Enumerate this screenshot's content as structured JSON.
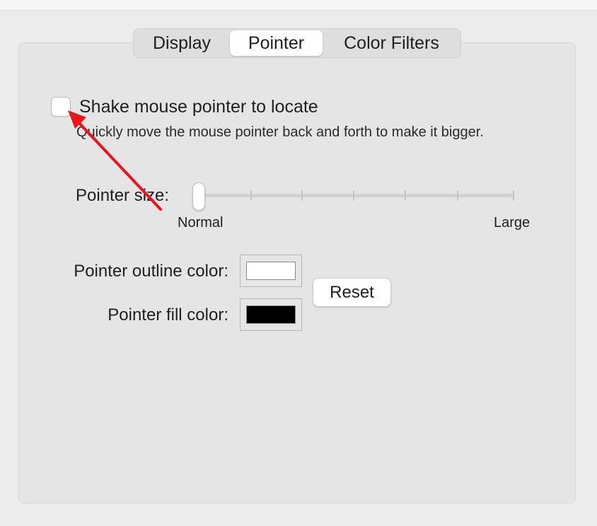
{
  "tabs": [
    {
      "label": "Display",
      "active": false
    },
    {
      "label": "Pointer",
      "active": true
    },
    {
      "label": "Color Filters",
      "active": false
    }
  ],
  "shake": {
    "label": "Shake mouse pointer to locate",
    "description": "Quickly move the mouse pointer back and forth to make it bigger.",
    "checked": false
  },
  "pointer_size": {
    "label": "Pointer size:",
    "min_label": "Normal",
    "max_label": "Large",
    "value": 0
  },
  "outline": {
    "label": "Pointer outline color:",
    "color": "#ffffff"
  },
  "fill": {
    "label": "Pointer fill color:",
    "color": "#000000"
  },
  "reset_label": "Reset",
  "annotation_color": "#e8161b"
}
